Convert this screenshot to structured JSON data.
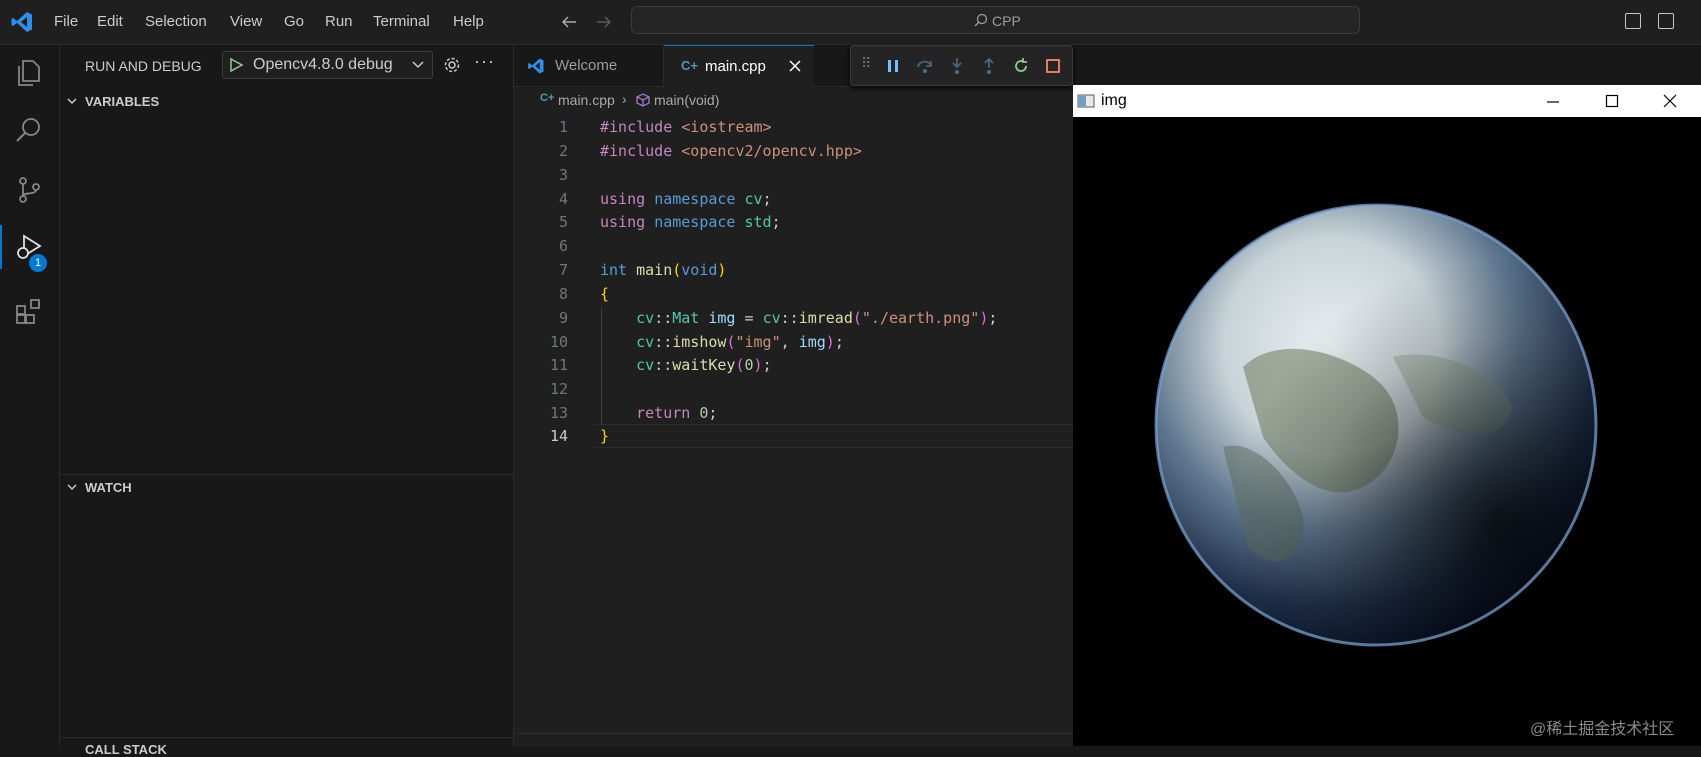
{
  "menu": [
    "File",
    "Edit",
    "Selection",
    "View",
    "Go",
    "Run",
    "Terminal",
    "Help"
  ],
  "command_center": {
    "label": "CPP"
  },
  "activity_bar": {
    "debug_badge": "1"
  },
  "sidebar": {
    "title": "RUN AND DEBUG",
    "config_name": "Opencv4.8.0 debug",
    "sections": {
      "variables": "VARIABLES",
      "watch": "WATCH",
      "call_stack": "CALL STACK"
    }
  },
  "editor": {
    "tabs": [
      {
        "label": "Welcome"
      },
      {
        "label": "main.cpp"
      }
    ],
    "breadcrumb": {
      "file": "main.cpp",
      "symbol": "main(void)"
    },
    "line_numbers": [
      "1",
      "2",
      "3",
      "4",
      "5",
      "6",
      "7",
      "8",
      "9",
      "10",
      "11",
      "12",
      "13",
      "14"
    ],
    "code": {
      "l1": {
        "directive": "#include",
        "header": "<iostream>"
      },
      "l2": {
        "directive": "#include",
        "header": "<opencv2/opencv.hpp>"
      },
      "l4": {
        "kw1": "using",
        "kw2": "namespace",
        "name": "cv",
        "end": ";"
      },
      "l5": {
        "kw1": "using",
        "kw2": "namespace",
        "name": "std",
        "end": ";"
      },
      "l7": {
        "type": "int",
        "fn": "main",
        "open": "(",
        "arg": "void",
        "close": ")"
      },
      "l8": {
        "brace": "{"
      },
      "l9": {
        "ns": "cv",
        "sep": "::",
        "type": "Mat",
        "var": "img",
        "eq": " = ",
        "ns2": "cv",
        "sep2": "::",
        "fn": "imread",
        "open": "(",
        "str": "\"./earth.png\"",
        "close": ")",
        "end": ";"
      },
      "l10": {
        "ns": "cv",
        "sep": "::",
        "fn": "imshow",
        "open": "(",
        "str": "\"img\"",
        "comma": ", ",
        "var": "img",
        "close": ")",
        "end": ";"
      },
      "l11": {
        "ns": "cv",
        "sep": "::",
        "fn": "waitKey",
        "open": "(",
        "num": "0",
        "close": ")",
        "end": ";"
      },
      "l13": {
        "kw": "return",
        "num": "0",
        "end": ";"
      },
      "l14": {
        "brace": "}"
      }
    }
  },
  "image_window": {
    "title": "img"
  },
  "watermark": "@稀土掘金技术社区",
  "colors": {
    "accent": "#0078d4",
    "background": "#181818",
    "editor_bg": "#1f1f1f"
  }
}
